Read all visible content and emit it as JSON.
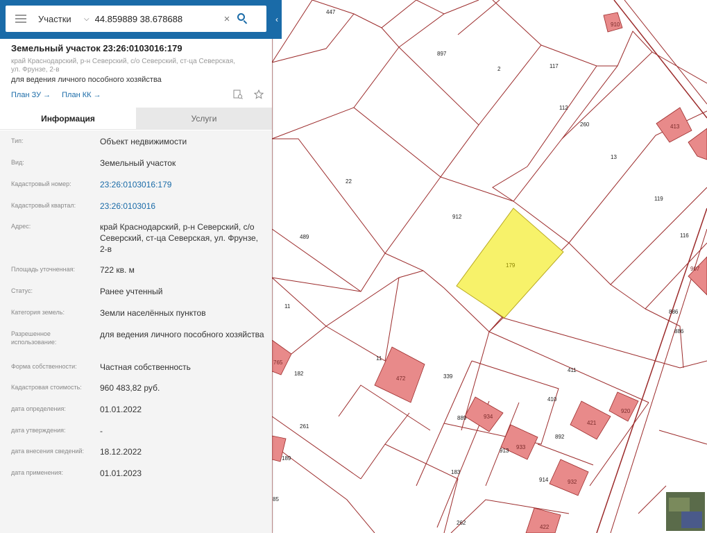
{
  "search": {
    "layer": "Участки",
    "value": "44.859889 38.678688",
    "placeholder": ""
  },
  "object": {
    "title": "Земельный участок 23:26:0103016:179",
    "address": "край Краснодарский, р-н Северский, с/о Северский, ст-ца Северская, ул. Фрунзе, 2-в",
    "purpose": "для ведения личного пособного хозяйства",
    "link_plan_zu": "План ЗУ →",
    "link_plan_kk": "План КК →"
  },
  "tabs": {
    "info": "Информация",
    "services": "Услуги"
  },
  "info_rows": [
    {
      "label": "Тип:",
      "value": "Объект недвижимости"
    },
    {
      "label": "Вид:",
      "value": "Земельный участок"
    },
    {
      "label": "Кадастровый номер:",
      "value": "23:26:0103016:179"
    },
    {
      "label": "Кадастровый квартал:",
      "value": "23:26:0103016"
    },
    {
      "label": "Адрес:",
      "value": "край Краснодарский, р-н Северский, с/о Северский, ст-ца Северская, ул. Фрунзе, 2-в"
    },
    {
      "label": "Площадь уточненная:",
      "value": "722 кв. м"
    },
    {
      "label": "Статус:",
      "value": "Ранее учтенный"
    },
    {
      "label": "Категория земель:",
      "value": "Земли населённых пунктов"
    },
    {
      "label": "Разрешенное использование:",
      "value": "для ведения личного пособного хозяйства"
    },
    {
      "label": "Форма собственности:",
      "value": "Частная собственность"
    },
    {
      "label": "Кадастровая стоимость:",
      "value": "960 483,82 руб."
    },
    {
      "label": "дата определения:",
      "value": "01.01.2022"
    },
    {
      "label": "дата утверждения:",
      "value": "-"
    },
    {
      "label": "дата внесения сведений:",
      "value": "18.12.2022"
    },
    {
      "label": "дата применения:",
      "value": "01.01.2023"
    }
  ],
  "map": {
    "selected_parcel": "179",
    "parcel_labels": [
      "447",
      "897",
      "2",
      "117",
      "112",
      "260",
      "13",
      "119",
      "116",
      "22",
      "912",
      "489",
      "11",
      "11",
      "886",
      "886",
      "182",
      "339",
      "411",
      "410",
      "889",
      "892",
      "261",
      "913",
      "914",
      "189",
      "183",
      "262",
      "85"
    ],
    "building_labels": [
      "910",
      "413",
      "907",
      "765",
      "472",
      "934",
      "920",
      "421",
      "933",
      "932",
      "422"
    ],
    "colors": {
      "parcel_line": "#9b2a2a",
      "building_fill": "#e88a8a",
      "selected_fill": "#f7f26a",
      "panel_accent": "#1a6ba8"
    }
  }
}
